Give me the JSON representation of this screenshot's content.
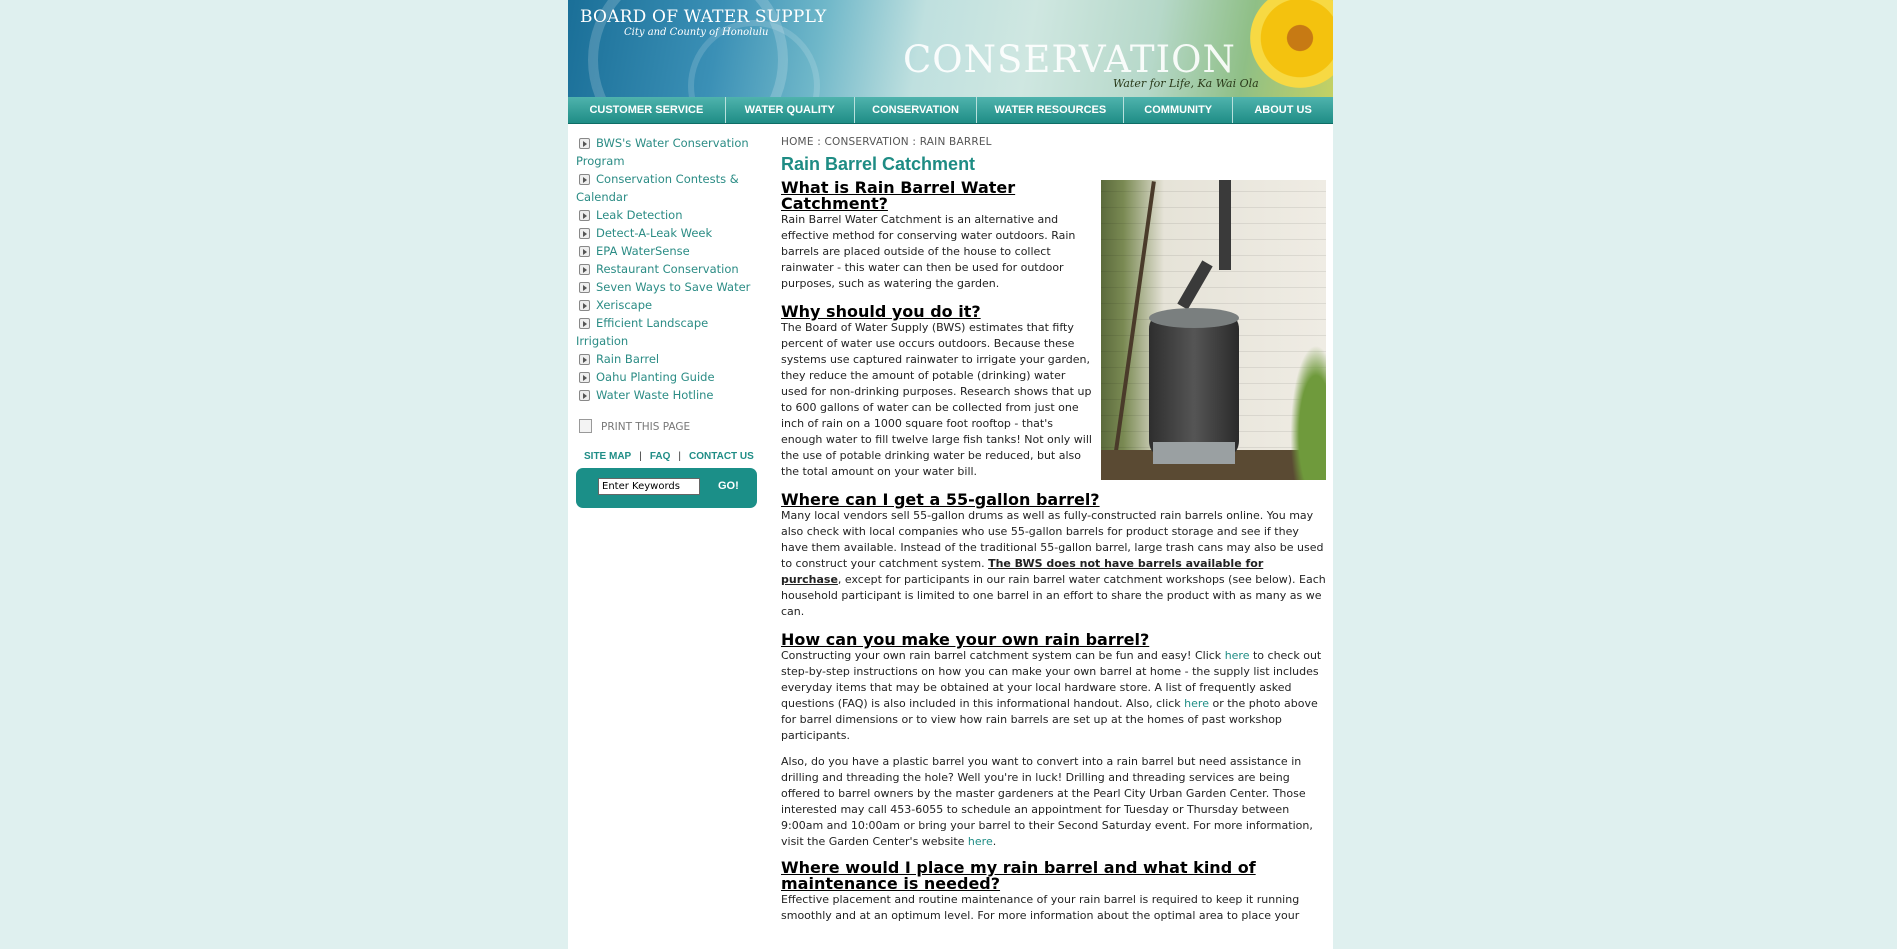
{
  "banner": {
    "org_line1": "BOARD OF WATER SUPPLY",
    "org_line2": "City and County of Honolulu",
    "hero": "CONSERVATION",
    "tagline": "Water for Life, Ka Wai Ola"
  },
  "nav": {
    "items": [
      "CUSTOMER SERVICE",
      "WATER QUALITY",
      "CONSERVATION",
      "WATER RESOURCES",
      "COMMUNITY",
      "ABOUT US"
    ]
  },
  "sidebar": {
    "items": [
      "BWS's Water Conservation Program",
      "Conservation Contests & Calendar",
      "Leak Detection",
      "Detect-A-Leak Week",
      "EPA WaterSense",
      "Restaurant Conservation",
      "Seven Ways to Save Water",
      "Xeriscape",
      "Efficient Landscape Irrigation",
      "Rain Barrel",
      "Oahu Planting Guide",
      "Water Waste Hotline"
    ],
    "print_label": "PRINT THIS PAGE",
    "quick_links": [
      "SITE MAP",
      "FAQ",
      "CONTACT US"
    ],
    "search_placeholder": "Enter Keywords",
    "search_button": "GO!"
  },
  "breadcrumb": [
    "HOME",
    "CONSERVATION",
    "RAIN BARREL"
  ],
  "page_title": "Rain Barrel Catchment",
  "sections": {
    "s1_heading": "What is Rain Barrel Water Catchment?",
    "s1_body": "Rain Barrel Water Catchment is an alternative and effective method for conserving water outdoors. Rain barrels are placed outside of the house to collect rainwater - this water can then be used for outdoor purposes, such as watering the garden.",
    "s2_heading": "Why should you do it?",
    "s2_body": "The Board of Water Supply (BWS) estimates that fifty percent of water use occurs outdoors.  Because these systems use captured rainwater to irrigate your garden, they reduce the amount of potable (drinking) water used for non-drinking purposes. Research shows that up to 600 gallons of water can be collected from just one inch of rain on a 1000 square foot rooftop - that's enough water to fill twelve large fish tanks! Not only will the use of potable drinking water be reduced, but also the total amount on your water bill.",
    "s3_heading": "Where can I get a 55-gallon barrel?",
    "s3_body_a": "Many local vendors sell 55-gallon drums as well as fully-constructed rain barrels online.  You may also check with local companies who use 55-gallon barrels for product storage and see if they have them available.  Instead of the traditional 55-gallon barrel, large trash cans may also be used to construct your catchment system.  ",
    "s3_body_bold": "The BWS does not have barrels available for purchase",
    "s3_body_b": ", except for participants in our rain barrel water catchment workshops (see below).  Each household participant is limited to one barrel in an effort to share the product with as many as we can.",
    "s4_heading": "How can you make your own rain barrel?",
    "s4_p1_a": "Constructing your own rain barrel catchment system can be fun and easy!  Click ",
    "s4_p1_link1": "here",
    "s4_p1_b": " to check out step-by-step instructions on how you can make your own barrel at home - the supply list includes everyday items that may be obtained at your local hardware store. A list of frequently asked questions (FAQ) is also included in this informational handout. Also, click ",
    "s4_p1_link2": "here",
    "s4_p1_c": " or the photo above for barrel dimensions or to view how rain barrels are set up at the homes of past workshop participants.",
    "s4_p2_a": "Also, do you have a plastic barrel you want to convert into a rain barrel but need assistance in drilling and threading the hole?  Well you're in luck!  Drilling and threading services are being offered to barrel owners by the master gardeners at the Pearl City Urban Garden Center.  Those interested may call 453-6055 to schedule an appointment for Tuesday or Thursday between 9:00am and 10:00am or bring your barrel to their Second Saturday event.  For more information, visit the Garden Center's website ",
    "s4_p2_link": "here",
    "s4_p2_b": ".",
    "s5_heading": "Where would I place my rain barrel and what kind of maintenance is needed?",
    "s5_body": "Effective placement and routine maintenance of your rain barrel is required to keep it running smoothly and at an optimum level. For more information about the optimal area to place your"
  },
  "colors": {
    "accent": "#1e8c84",
    "page_bg": "#dff0ef",
    "nav_bg": "#1f8d86"
  }
}
